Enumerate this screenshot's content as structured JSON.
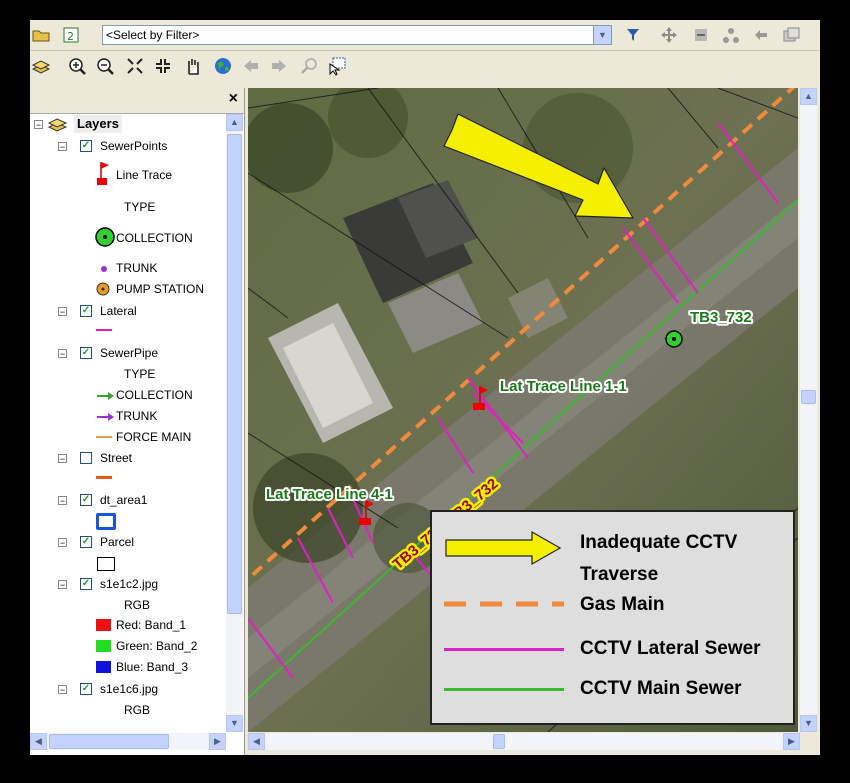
{
  "toolbar": {
    "select_by_filter": "<Select by Filter>"
  },
  "toc": {
    "close_label": "×",
    "layers_label": "Layers",
    "items": [
      {
        "label": "SewerPoints"
      },
      {
        "label": "Line Trace"
      },
      {
        "label": "TYPE"
      },
      {
        "label": "COLLECTION"
      },
      {
        "label": "TRUNK"
      },
      {
        "label": "PUMP STATION"
      },
      {
        "label": "Lateral"
      },
      {
        "label": "SewerPipe"
      },
      {
        "label": "TYPE"
      },
      {
        "label": "COLLECTION"
      },
      {
        "label": "TRUNK"
      },
      {
        "label": "FORCE MAIN"
      },
      {
        "label": "Street"
      },
      {
        "label": "dt_area1"
      },
      {
        "label": "Parcel"
      },
      {
        "label": "s1e1c2.jpg"
      },
      {
        "label": "RGB"
      },
      {
        "label": "Red:   Band_1"
      },
      {
        "label": "Green: Band_2"
      },
      {
        "label": "Blue:   Band_3"
      },
      {
        "label": "s1e1c6.jpg"
      },
      {
        "label": "RGB"
      }
    ]
  },
  "map": {
    "labels": {
      "tb3": "TB3_732",
      "lat1": "Lat Trace Line 1-1",
      "lat4": "Lat Trace Line 4-1",
      "pipe": "TB3_733_TB3_732"
    }
  },
  "legend": {
    "items": [
      {
        "label": "Inadequate CCTV"
      },
      {
        "label": "Traverse"
      },
      {
        "label": "Gas Main"
      },
      {
        "label": "CCTV Lateral Sewer"
      },
      {
        "label": "CCTV Main Sewer"
      }
    ]
  },
  "colors": {
    "gas_main": "#f08a3c",
    "lateral": "#e020c0",
    "main_sewer": "#3cb82e",
    "arrow": "#f5f000"
  }
}
